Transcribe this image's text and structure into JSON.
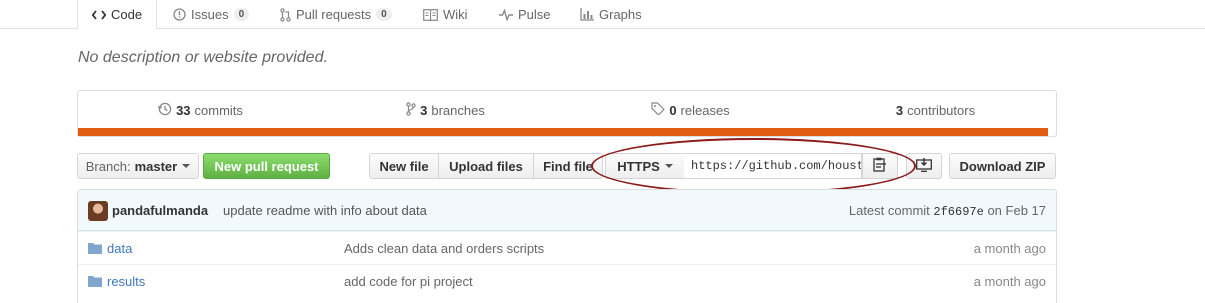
{
  "tabs": [
    {
      "label": "Code",
      "icon": "code-icon"
    },
    {
      "label": "Issues",
      "count": "0",
      "icon": "issue-icon"
    },
    {
      "label": "Pull requests",
      "count": "0",
      "icon": "pull-request-icon"
    },
    {
      "label": "Wiki",
      "icon": "book-icon"
    },
    {
      "label": "Pulse",
      "icon": "pulse-icon"
    },
    {
      "label": "Graphs",
      "icon": "graph-icon"
    }
  ],
  "description": "No description or website provided.",
  "summary": {
    "commits_count": "33",
    "commits_label": "commits",
    "branches_count": "3",
    "branches_label": "branches",
    "releases_count": "0",
    "releases_label": "releases",
    "contributors_count": "3",
    "contributors_label": "contributors",
    "language_color": "#e05d12"
  },
  "file_nav": {
    "branch_label": "Branch:",
    "branch_value": "master",
    "new_pr": "New pull request",
    "new_file": "New file",
    "upload_files": "Upload files",
    "find_file": "Find file",
    "protocol": "HTTPS",
    "clone_url": "https://github.com/housto",
    "download_zip": "Download ZIP"
  },
  "latest_commit": {
    "author": "pandafulmanda",
    "message": "update readme with info about data",
    "prefix": "Latest commit",
    "sha": "2f6697e",
    "date": "on Feb 17"
  },
  "files": [
    {
      "name": "data",
      "message": "Adds clean data and orders scripts",
      "age": "a month ago"
    },
    {
      "name": "results",
      "message": "add code for pi project",
      "age": "a month ago"
    }
  ]
}
